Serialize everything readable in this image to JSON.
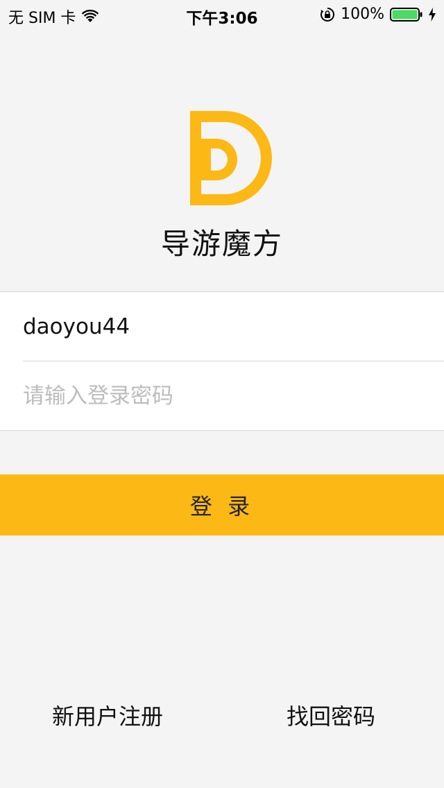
{
  "status_bar": {
    "carrier": "无 SIM 卡",
    "time": "下午3:06",
    "battery_percent": "100%",
    "icons": [
      "wifi-icon",
      "lock-rotation-icon",
      "battery-icon",
      "charging-icon"
    ]
  },
  "app": {
    "name": "导游魔方",
    "logo_letter": "D",
    "brand_color": "#fcb814"
  },
  "login_form": {
    "username_value": "daoyou44",
    "password_placeholder": "请输入登录密码",
    "submit_label": "登 录"
  },
  "links": {
    "register_label": "新用户注册",
    "forgot_password_label": "找回密码"
  }
}
